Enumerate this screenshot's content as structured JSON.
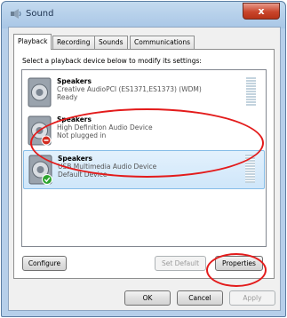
{
  "window": {
    "title": "Sound",
    "close_glyph": "x"
  },
  "tabs": [
    {
      "label": "Playback",
      "active": true
    },
    {
      "label": "Recording",
      "active": false
    },
    {
      "label": "Sounds",
      "active": false
    },
    {
      "label": "Communications",
      "active": false
    }
  ],
  "panel": {
    "instructions": "Select a playback device below to modify its settings:"
  },
  "devices": [
    {
      "name": "Speakers",
      "description": "Creative AudioPCI (ES1371,ES1373) (WDM)",
      "status": "Ready",
      "icon": "speaker-icon"
    },
    {
      "name": "Speakers",
      "description": "High Definition Audio Device",
      "status": "Not plugged in",
      "icon": "speaker-icon"
    },
    {
      "name": "Speakers",
      "description": "USB Multimedia Audio Device",
      "status": "Default Device",
      "icon": "speaker-icon",
      "default_badge": "green-checkmark-icon"
    }
  ],
  "buttons": {
    "configure": "Configure",
    "set_default": "Set Default",
    "properties": "Properties",
    "ok": "OK",
    "cancel": "Cancel",
    "apply": "Apply"
  },
  "colors": {
    "annotation": "#e31b1b",
    "selection": "#cfe6fa"
  }
}
